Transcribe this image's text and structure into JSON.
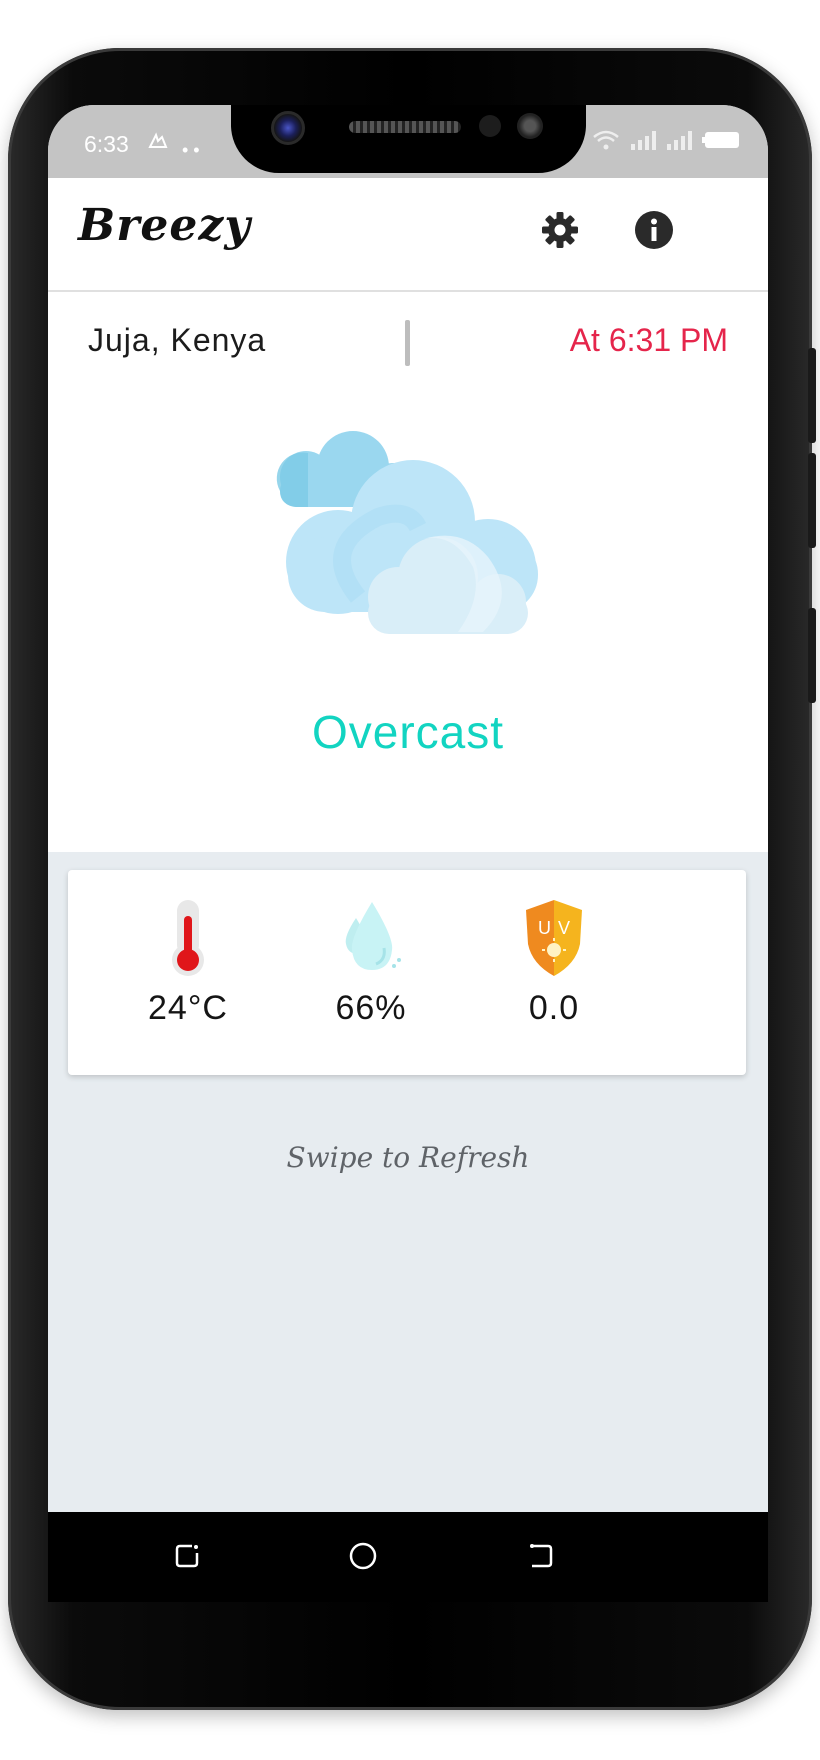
{
  "status_bar": {
    "time": "6:33"
  },
  "app_bar": {
    "title": "Breezy"
  },
  "summary": {
    "location": "Juja, Kenya",
    "updated_at": "At 6:31 PM",
    "condition": "Overcast"
  },
  "metrics": {
    "temperature": "24°C",
    "humidity": "66%",
    "uv_index": "0.0"
  },
  "hint": "Swipe to Refresh",
  "colors": {
    "accent_condition": "#12d4c1",
    "accent_time": "#e5254b",
    "background": "#e7ecf0"
  }
}
